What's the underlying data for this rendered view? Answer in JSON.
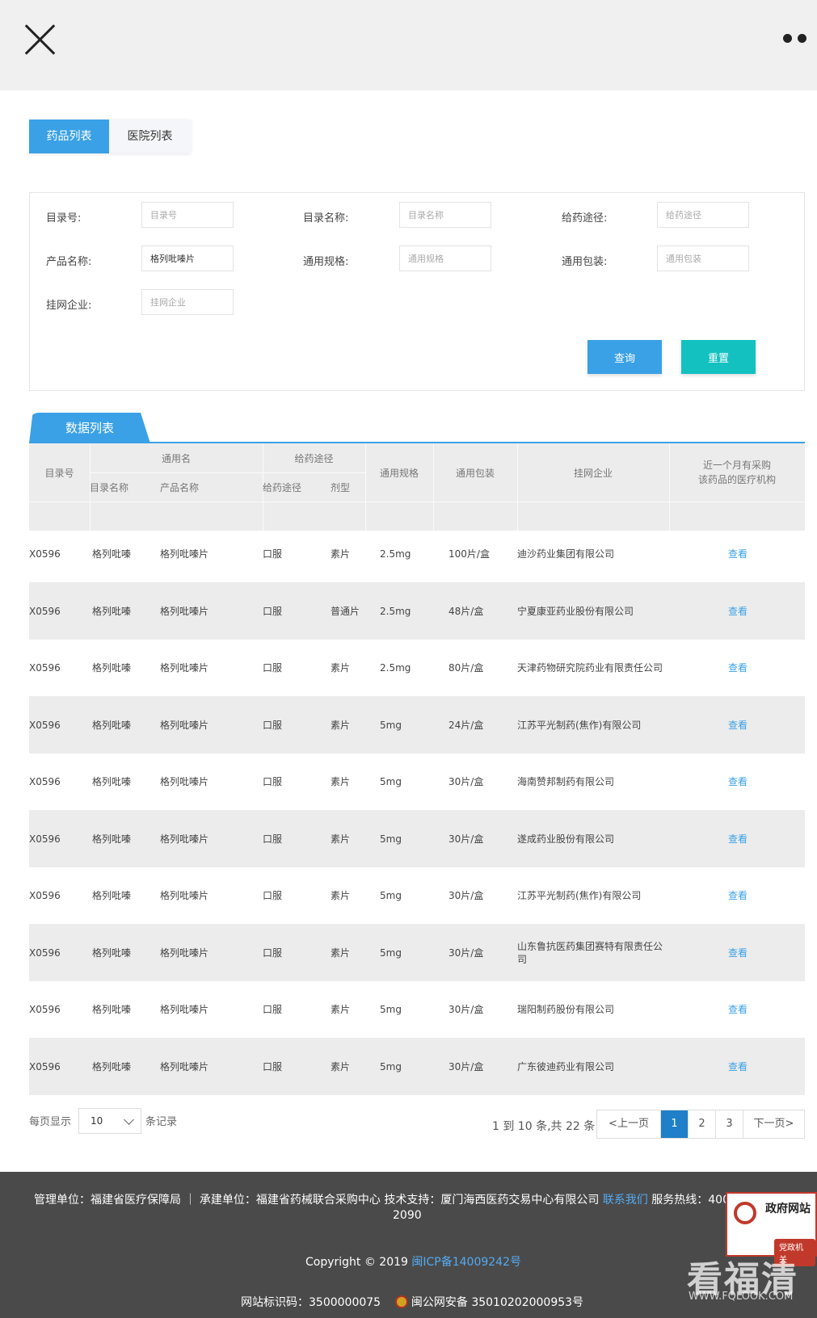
{
  "tabs": [
    {
      "label": "药品列表",
      "active": true
    },
    {
      "label": "医院列表",
      "active": false
    }
  ],
  "filters": {
    "catalog_no": {
      "label": "目录号:",
      "placeholder": "目录号",
      "value": ""
    },
    "catalog_name": {
      "label": "目录名称:",
      "placeholder": "目录名称",
      "value": ""
    },
    "route": {
      "label": "给药途径:",
      "placeholder": "给药途径",
      "value": ""
    },
    "product_name": {
      "label": "产品名称:",
      "placeholder": "产品名称",
      "value": "格列吡嗪片"
    },
    "spec": {
      "label": "通用规格:",
      "placeholder": "通用规格",
      "value": ""
    },
    "package": {
      "label": "通用包装:",
      "placeholder": "通用包装",
      "value": ""
    },
    "enterprise": {
      "label": "挂网企业:",
      "placeholder": "挂网企业",
      "value": ""
    }
  },
  "buttons": {
    "query": "查询",
    "reset": "重置"
  },
  "data_list_title": "数据列表",
  "table": {
    "headers": {
      "catalog_no": "目录号",
      "generic_group": "通用名",
      "catalog_name": "目录名称",
      "product_name": "产品名称",
      "route_group": "给药途径",
      "route": "给药途径",
      "dosage_form": "剂型",
      "spec": "通用规格",
      "package": "通用包装",
      "enterprise": "挂网企业",
      "hospitals_line1": "近一个月有采购",
      "hospitals_line2": "该药品的医疗机构"
    },
    "rows": [
      {
        "catalog_no": "X0596",
        "catalog_name": "格列吡嗪",
        "product_name": "格列吡嗪片",
        "route": "口服",
        "form": "素片",
        "spec": "2.5mg",
        "package": "100片/盒",
        "enterprise": "迪沙药业集团有限公司",
        "action": "查看"
      },
      {
        "catalog_no": "X0596",
        "catalog_name": "格列吡嗪",
        "product_name": "格列吡嗪片",
        "route": "口服",
        "form": "普通片",
        "spec": "2.5mg",
        "package": "48片/盒",
        "enterprise": "宁夏康亚药业股份有限公司",
        "action": "查看"
      },
      {
        "catalog_no": "X0596",
        "catalog_name": "格列吡嗪",
        "product_name": "格列吡嗪片",
        "route": "口服",
        "form": "素片",
        "spec": "2.5mg",
        "package": "80片/盒",
        "enterprise": "天津药物研究院药业有限责任公司",
        "action": "查看"
      },
      {
        "catalog_no": "X0596",
        "catalog_name": "格列吡嗪",
        "product_name": "格列吡嗪片",
        "route": "口服",
        "form": "素片",
        "spec": "5mg",
        "package": "24片/盒",
        "enterprise": "江苏平光制药(焦作)有限公司",
        "action": "查看"
      },
      {
        "catalog_no": "X0596",
        "catalog_name": "格列吡嗪",
        "product_name": "格列吡嗪片",
        "route": "口服",
        "form": "素片",
        "spec": "5mg",
        "package": "30片/盒",
        "enterprise": "海南赞邦制药有限公司",
        "action": "查看"
      },
      {
        "catalog_no": "X0596",
        "catalog_name": "格列吡嗪",
        "product_name": "格列吡嗪片",
        "route": "口服",
        "form": "素片",
        "spec": "5mg",
        "package": "30片/盒",
        "enterprise": "遂成药业股份有限公司",
        "action": "查看"
      },
      {
        "catalog_no": "X0596",
        "catalog_name": "格列吡嗪",
        "product_name": "格列吡嗪片",
        "route": "口服",
        "form": "素片",
        "spec": "5mg",
        "package": "30片/盒",
        "enterprise": "江苏平光制药(焦作)有限公司",
        "action": "查看"
      },
      {
        "catalog_no": "X0596",
        "catalog_name": "格列吡嗪",
        "product_name": "格列吡嗪片",
        "route": "口服",
        "form": "素片",
        "spec": "5mg",
        "package": "30片/盒",
        "enterprise": "山东鲁抗医药集团赛特有限责任公司",
        "action": "查看"
      },
      {
        "catalog_no": "X0596",
        "catalog_name": "格列吡嗪",
        "product_name": "格列吡嗪片",
        "route": "口服",
        "form": "素片",
        "spec": "5mg",
        "package": "30片/盒",
        "enterprise": "瑞阳制药股份有限公司",
        "action": "查看"
      },
      {
        "catalog_no": "X0596",
        "catalog_name": "格列吡嗪",
        "product_name": "格列吡嗪片",
        "route": "口服",
        "form": "素片",
        "spec": "5mg",
        "package": "30片/盒",
        "enterprise": "广东彼迪药业有限公司",
        "action": "查看"
      }
    ]
  },
  "pagination": {
    "per_page_prefix": "每页显示",
    "per_page_value": "10",
    "per_page_suffix": "条记录",
    "summary": "1 到 10 条,共 22 条",
    "prev": "<上一页",
    "pages": [
      "1",
      "2",
      "3"
    ],
    "current_page": "1",
    "next": "下一页>"
  },
  "footer": {
    "line1": "管理单位：福建省医疗保障局 ｜ 承建单位：福建省药械联合采购中心 技术支持：厦门海西医药交易中心有限公司",
    "contact_link": "联系我们",
    "hotline": "服务热线：400-518-",
    "hotline_cont": "2090",
    "copyright_prefix": "Copyright © 2019 ",
    "icp_link": "闽ICP备14009242号",
    "site_id": "网站标识码：3500000075",
    "police_record": "闽公网安备 35010202000953号",
    "badge_text": "政府网站",
    "badge_sub": "党政机关"
  },
  "watermark": {
    "text": "看福清",
    "url": "WWW.FQLOOK.COM"
  },
  "colors": {
    "accent": "#3aa1e6",
    "reset": "#14c1c1",
    "footer_bg": "#4a4a4a",
    "link": "#3aa1e6"
  }
}
